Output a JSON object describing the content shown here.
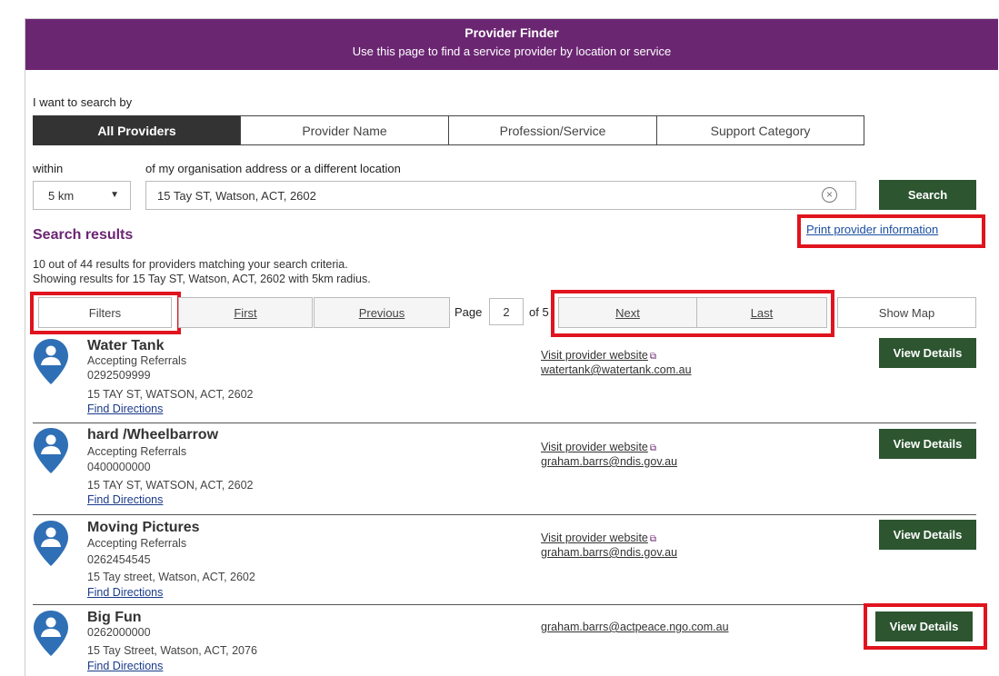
{
  "header": {
    "title": "Provider Finder",
    "subtitle": "Use this page to find a service provider by location or service"
  },
  "search_by": {
    "label": "I want to search by",
    "tabs": [
      {
        "label": "All Providers",
        "active": true
      },
      {
        "label": "Provider Name",
        "active": false
      },
      {
        "label": "Profession/Service",
        "active": false
      },
      {
        "label": "Support Category",
        "active": false
      }
    ]
  },
  "location": {
    "within_label": "within",
    "of_label": "of my organisation address or a different location",
    "radius": "5 km",
    "address": "15 Tay ST, Watson, ACT, 2602",
    "search_button": "Search"
  },
  "results": {
    "title": "Search results",
    "print_link": "Print provider information",
    "summary_line1": "10 out of 44 results for providers matching your search criteria.",
    "summary_line2": "Showing results for 15 Tay ST, Watson, ACT, 2602 with 5km radius."
  },
  "pagination": {
    "filters": "Filters",
    "first": "First",
    "previous": "Previous",
    "page_label": "Page",
    "page_value": "2",
    "of_label": "of 5",
    "next": "Next",
    "last": "Last",
    "show_map": "Show Map"
  },
  "providers": [
    {
      "name": "Water Tank",
      "status": "Accepting Referrals",
      "phone": "0292509999",
      "address": "15 TAY ST, WATSON, ACT, 2602",
      "directions": "Find Directions",
      "website": "Visit provider website",
      "email": "watertank@watertank.com.au",
      "action": "View Details"
    },
    {
      "name": "hard /Wheelbarrow",
      "status": "Accepting Referrals",
      "phone": "0400000000",
      "address": "15 TAY ST, WATSON, ACT, 2602",
      "directions": "Find Directions",
      "website": "Visit provider website",
      "email": "graham.barrs@ndis.gov.au",
      "action": "View Details"
    },
    {
      "name": "Moving Pictures",
      "status": "Accepting Referrals",
      "phone": "0262454545",
      "address": "15 Tay street, Watson, ACT, 2602",
      "directions": "Find Directions",
      "website": "Visit provider website",
      "email": "graham.barrs@ndis.gov.au",
      "action": "View Details"
    },
    {
      "name": "Big Fun",
      "phone": "0262000000",
      "address": "15 Tay Street, Watson, ACT, 2076",
      "directions": "Find Directions",
      "email": "graham.barrs@actpeace.ngo.com.au",
      "action": "View Details"
    }
  ],
  "icons": {
    "pin": "person-location-pin-icon",
    "external": "external-link-icon",
    "clear": "clear-circle-icon",
    "caret": "caret-down-icon"
  },
  "colors": {
    "brand_purple": "#6b2672",
    "button_green": "#2c5530",
    "pin_blue": "#2f6fb5",
    "highlight_red": "#e0141e"
  }
}
